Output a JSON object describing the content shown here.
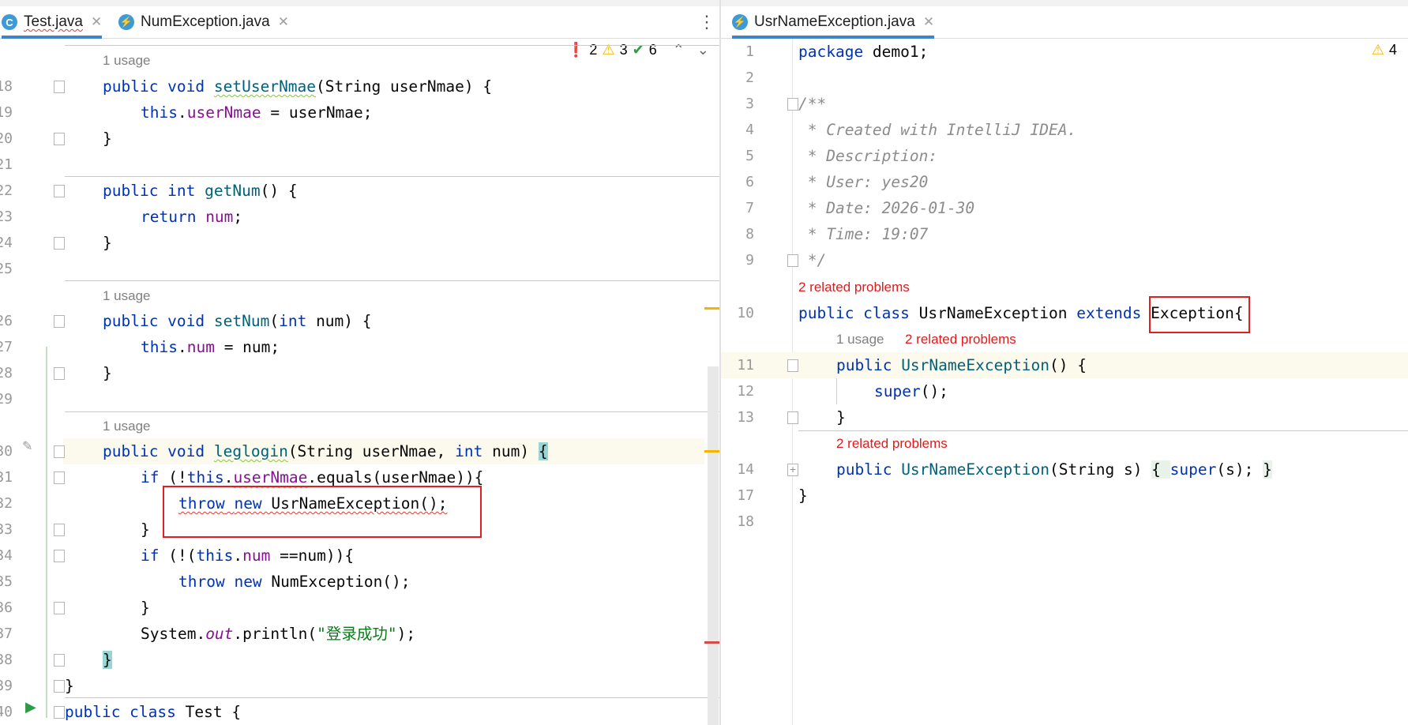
{
  "left_tabs": [
    {
      "label": "Test.java",
      "icon": "C"
    },
    {
      "label": "NumException.java",
      "icon": "⚡"
    }
  ],
  "right_tabs": [
    {
      "label": "UsrNameException.java",
      "icon": "⚡"
    }
  ],
  "left_inspections": {
    "errors": "2",
    "warnings": "3",
    "ok": "6"
  },
  "right_inspections": {
    "warnings": "4"
  },
  "hints": {
    "usage": "1 usage",
    "related": "2 related problems"
  },
  "left_line_numbers": [
    "18",
    "19",
    "20",
    "21",
    "22",
    "23",
    "24",
    "25",
    "26",
    "27",
    "28",
    "29",
    "30",
    "31",
    "32",
    "33",
    "34",
    "35",
    "36",
    "37",
    "38",
    "39",
    "40"
  ],
  "right_line_numbers": [
    "1",
    "2",
    "3",
    "4",
    "5",
    "6",
    "7",
    "8",
    "9",
    "10",
    "11",
    "12",
    "13",
    "14",
    "17",
    "18"
  ],
  "left_code": {
    "setUserNmae_sig": [
      "public void ",
      "setUserNmae",
      "(String userNmae) {"
    ],
    "setUserNmae_body": [
      "this",
      ".",
      "userNmae",
      " = userNmae;"
    ],
    "getNum_sig": [
      "public int ",
      "getNum",
      "() {"
    ],
    "getNum_body": [
      "return ",
      "num",
      ";"
    ],
    "setNum_sig": [
      "public void ",
      "setNum",
      "(",
      "int",
      " num) {"
    ],
    "setNum_body": [
      "this",
      ".",
      "num",
      " = num;"
    ],
    "leglogin_sig": [
      "public void ",
      "leglogin",
      "(String userNmae, ",
      "int",
      " num) ",
      "{"
    ],
    "if1": [
      "if",
      " (!",
      "this",
      ".",
      "userNmae",
      ".equals(userNmae)){"
    ],
    "throw1": [
      "throw",
      " ",
      "new",
      " UsrNameException();"
    ],
    "if2": [
      "if",
      " (!(",
      "this",
      ".",
      "num",
      " ==num)){"
    ],
    "throw2": [
      "throw",
      " ",
      "new",
      " NumException();"
    ],
    "println": [
      "System.",
      "out",
      ".println(",
      "\"登录成功\"",
      ");"
    ],
    "class_decl": [
      "public class ",
      "Test {"
    ],
    "close": "}"
  },
  "right_code": {
    "package": [
      "package",
      " demo1;"
    ],
    "c3": "/**",
    "c4": " * Created with IntelliJ IDEA.",
    "c5": " * Description:",
    "c6": " * User: yes20",
    "c7": " * Date: 2026-01-30",
    "c8": " * Time: 19:07",
    "c9": " */",
    "class_decl": [
      "public class ",
      "UsrNameException ",
      "extends",
      " ",
      "Exception",
      "{"
    ],
    "ctor1": [
      "public ",
      "UsrNameException",
      "() {"
    ],
    "super1": [
      "super",
      "();"
    ],
    "close_inner": "}",
    "ctor2": [
      "public ",
      "UsrNameException",
      "(String s) ",
      "{ ",
      "super",
      "(s); ",
      "}"
    ],
    "close_outer": "}"
  }
}
